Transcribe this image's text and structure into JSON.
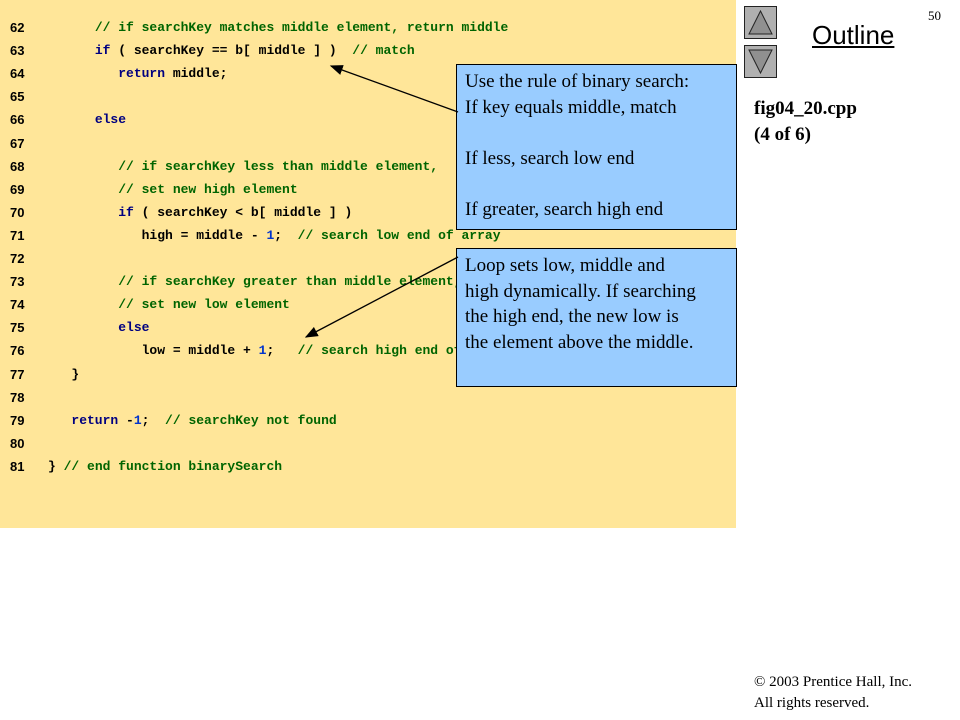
{
  "page_number": "50",
  "outline": {
    "title": "Outline",
    "nav_up_icon": "triangle-up-icon",
    "nav_down_icon": "triangle-down-icon"
  },
  "figure": {
    "file": "fig04_20.cpp",
    "part": "(4 of 6)"
  },
  "code_lines": [
    {
      "num": "62",
      "tokens": [
        {
          "t": "      ",
          "c": "pl"
        },
        {
          "t": "// if searchKey matches middle element, return middle",
          "c": "cm"
        }
      ]
    },
    {
      "num": "63",
      "tokens": [
        {
          "t": "      ",
          "c": "pl"
        },
        {
          "t": "if",
          "c": "kw"
        },
        {
          "t": " ( searchKey == b[ middle ] )  ",
          "c": "pl"
        },
        {
          "t": "// match",
          "c": "cm"
        }
      ]
    },
    {
      "num": "64",
      "tokens": [
        {
          "t": "         ",
          "c": "pl"
        },
        {
          "t": "return",
          "c": "kw"
        },
        {
          "t": " middle;",
          "c": "pl"
        }
      ]
    },
    {
      "num": "65",
      "tokens": []
    },
    {
      "num": "66",
      "tokens": [
        {
          "t": "      ",
          "c": "pl"
        },
        {
          "t": "else",
          "c": "kw"
        }
      ]
    },
    {
      "num": "67",
      "tokens": []
    },
    {
      "num": "68",
      "tokens": [
        {
          "t": "         ",
          "c": "pl"
        },
        {
          "t": "// if searchKey less than middle element,",
          "c": "cm"
        }
      ]
    },
    {
      "num": "69",
      "tokens": [
        {
          "t": "         ",
          "c": "pl"
        },
        {
          "t": "// set new high element",
          "c": "cm"
        }
      ]
    },
    {
      "num": "70",
      "tokens": [
        {
          "t": "         ",
          "c": "pl"
        },
        {
          "t": "if",
          "c": "kw"
        },
        {
          "t": " ( searchKey < b[ middle ] )",
          "c": "pl"
        }
      ]
    },
    {
      "num": "71",
      "tokens": [
        {
          "t": "            high = middle - ",
          "c": "pl"
        },
        {
          "t": "1",
          "c": "nu"
        },
        {
          "t": ";  ",
          "c": "pl"
        },
        {
          "t": "// search low end of array",
          "c": "cm"
        }
      ]
    },
    {
      "num": "72",
      "tokens": []
    },
    {
      "num": "73",
      "tokens": [
        {
          "t": "         ",
          "c": "pl"
        },
        {
          "t": "// if searchKey greater than middle element,",
          "c": "cm"
        }
      ]
    },
    {
      "num": "74",
      "tokens": [
        {
          "t": "         ",
          "c": "pl"
        },
        {
          "t": "// set new low element",
          "c": "cm"
        }
      ]
    },
    {
      "num": "75",
      "tokens": [
        {
          "t": "         ",
          "c": "pl"
        },
        {
          "t": "else",
          "c": "kw"
        }
      ]
    },
    {
      "num": "76",
      "tokens": [
        {
          "t": "            low = middle + ",
          "c": "pl"
        },
        {
          "t": "1",
          "c": "nu"
        },
        {
          "t": ";   ",
          "c": "pl"
        },
        {
          "t": "// search high end of array",
          "c": "cm"
        }
      ]
    },
    {
      "num": "77",
      "tokens": [
        {
          "t": "   }",
          "c": "pl"
        }
      ]
    },
    {
      "num": "78",
      "tokens": []
    },
    {
      "num": "79",
      "tokens": [
        {
          "t": "   ",
          "c": "pl"
        },
        {
          "t": "return",
          "c": "kw"
        },
        {
          "t": " -",
          "c": "pl"
        },
        {
          "t": "1",
          "c": "nu"
        },
        {
          "t": ";  ",
          "c": "pl"
        },
        {
          "t": "// searchKey not found",
          "c": "cm"
        }
      ]
    },
    {
      "num": "80",
      "tokens": []
    },
    {
      "num": "81",
      "tokens": [
        {
          "t": "} ",
          "c": "pl"
        },
        {
          "t": "// end function binarySearch",
          "c": "cm"
        }
      ]
    }
  ],
  "callouts": [
    {
      "id": "binary-search-rule",
      "lines": [
        "Use the rule of binary search:",
        "If key equals middle, match",
        "",
        "If less, search low end",
        "",
        "If greater, search high end"
      ]
    },
    {
      "id": "loop-dynamic",
      "lines": [
        "Loop sets low, middle and",
        "high dynamically. If searching",
        "the high end, the new low is",
        "the element above the middle."
      ]
    }
  ],
  "copyright": {
    "line1": "© 2003 Prentice Hall, Inc.",
    "line2": "All rights reserved."
  }
}
